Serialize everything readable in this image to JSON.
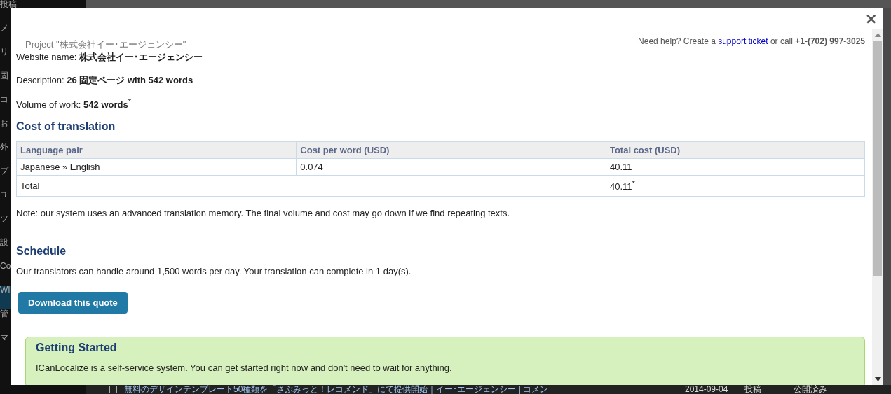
{
  "background": {
    "sidebar_items": [
      {
        "label": "投稿",
        "selected": false
      },
      {
        "label": "メ",
        "selected": false
      },
      {
        "label": "リ",
        "selected": false
      },
      {
        "label": "固",
        "selected": false
      },
      {
        "label": "コ",
        "selected": false
      },
      {
        "label": "お",
        "selected": false
      },
      {
        "label": "外",
        "selected": false
      },
      {
        "label": "プ",
        "selected": false
      },
      {
        "label": "ユ",
        "selected": false
      },
      {
        "label": "ツ",
        "selected": false
      },
      {
        "label": "設",
        "selected": false
      },
      {
        "label": "Co",
        "selected": false
      },
      {
        "label": "WI",
        "selected": true
      },
      {
        "label": "管",
        "selected": false
      },
      {
        "label": "マ",
        "selected": false
      }
    ],
    "post_row": {
      "checked": false,
      "title": "無料のデザインテンプレート50種類を「さぶみっと！レコメンド」にて提供開始｜イー･エージェンシー | コメン",
      "date": "2014-09-04",
      "type": "投稿",
      "status": "公開済み"
    }
  },
  "modal": {
    "close": "×",
    "project_title": "Project \"株式会社イー･エージェンシー\"",
    "help": {
      "before": "Need help? Create a",
      "link": "support ticket",
      "after": "or call **+1-(702) 997-3025**"
    },
    "fields": [
      "Website name: **株式会社イー･エージェンシー**",
      "Description: **26 固定ページ with 542 words**",
      "Volume of work: **542 words**$^{*}$"
    ],
    "cost_heading": "Cost of translation",
    "table": {
      "columns": [
        "Language pair",
        "Cost per word (USD)",
        "Total cost (USD)"
      ],
      "rows": [
        {
          "kind": "item",
          "cells": [
            "Japanese » English",
            "0.074",
            "40.11"
          ]
        },
        {
          "kind": "total",
          "cells": [
            {
              "text": "Total",
              "colspan": 2
            },
            {
              "text": "40.11$^{*}$"
            }
          ]
        }
      ]
    },
    "note": "Note: our system uses an advanced translation memory. The final volume and cost may go down if we find repeating texts.",
    "schedule_heading": "Schedule",
    "schedule_text": "Our translators can handle around 1,500 words per day. Your translation can complete in 1 day(s).",
    "download_button": "Download this quote",
    "getting_started": {
      "heading": "Getting Started",
      "text": "ICanLocalize is a self-service system. You can get started right now and don't need to wait for anything."
    }
  }
}
